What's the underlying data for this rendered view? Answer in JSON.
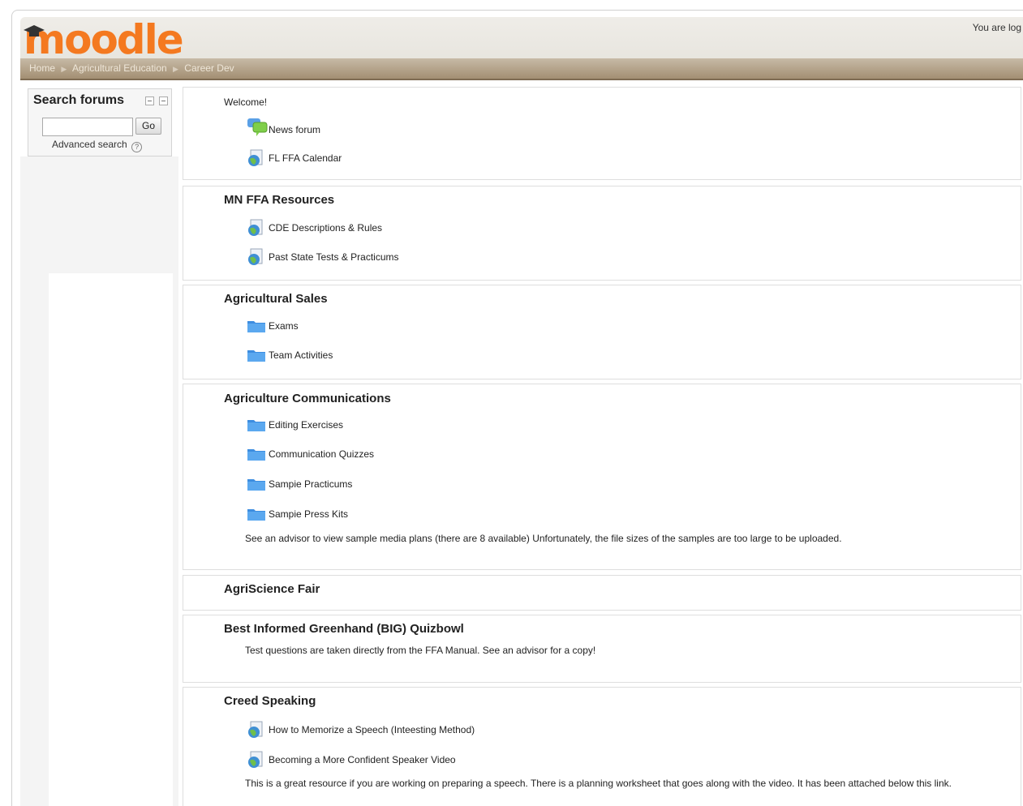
{
  "header": {
    "logo_text": "moodle",
    "login_info": "You are log",
    "breadcrumb": [
      "Home",
      "Agricultural Education",
      "Career Dev"
    ],
    "brand_color": "#f47920"
  },
  "sidebar": {
    "block_title": "Search forums",
    "search_value": "",
    "go_label": "Go",
    "advanced_label": "Advanced search",
    "help_icon": "?"
  },
  "sections": {
    "welcome": {
      "title": "Welcome!",
      "items": [
        {
          "icon": "forum-icon",
          "label": "News forum"
        },
        {
          "icon": "globe-resource-icon",
          "label": "FL FFA Calendar"
        }
      ]
    },
    "mn_ffa": {
      "title": "MN FFA Resources",
      "items": [
        {
          "icon": "globe-resource-icon",
          "label": "CDE Descriptions & Rules"
        },
        {
          "icon": "globe-resource-icon",
          "label": "Past State Tests & Practicums"
        }
      ]
    },
    "sales": {
      "title": "Agricultural Sales",
      "items": [
        {
          "icon": "folder-icon",
          "label": "Exams"
        },
        {
          "icon": "folder-icon",
          "label": "Team Activities"
        }
      ]
    },
    "comms": {
      "title": "Agriculture Communications",
      "items": [
        {
          "icon": "folder-icon",
          "label": "Editing Exercises"
        },
        {
          "icon": "folder-icon",
          "label": "Communication Quizzes"
        },
        {
          "icon": "folder-icon",
          "label": "Sampie Practicums"
        },
        {
          "icon": "folder-icon",
          "label": "Sampie Press Kits"
        }
      ],
      "note": "See an advisor to view sample media plans (there are 8 available)  Unfortunately, the file sizes of the samples are too large to be uploaded."
    },
    "agrisci": {
      "title": "AgriScience Fair"
    },
    "big": {
      "title": "Best Informed Greenhand (BIG) Quizbowl",
      "note": "Test questions are taken directly from the FFA Manual.  See an advisor for a copy!"
    },
    "creed": {
      "title": "Creed Speaking",
      "items": [
        {
          "icon": "globe-resource-icon",
          "label": "How to Memorize a Speech (Inteesting Method)"
        },
        {
          "icon": "globe-resource-icon",
          "label": "Becoming a More Confident Speaker Video"
        }
      ],
      "note": "This is a great resource if you are working on preparing a speech.  There is a planning worksheet that goes along with the video.  It has been attached below this link."
    }
  }
}
